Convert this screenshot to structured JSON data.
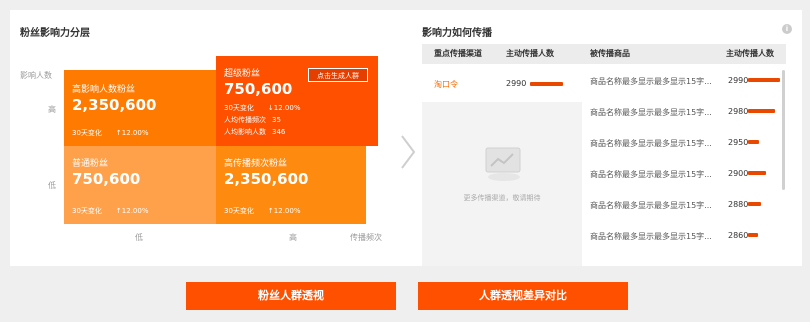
{
  "left": {
    "title": "粉丝影响力分层",
    "y_axis_label": "影响人数",
    "y_high": "高",
    "y_low": "低",
    "x_low": "低",
    "x_high": "高",
    "x_axis_label": "传播频次",
    "quadrants": {
      "high_influence": {
        "name": "高影响人数粉丝",
        "value": "2,350,600",
        "change_label": "30天变化",
        "change_value": "↑12.00%"
      },
      "super": {
        "name": "超级粉丝",
        "value": "750,600",
        "change_label": "30天变化",
        "change_value": "↓12.00%",
        "spread_label": "人均传播频次",
        "spread_value": "35",
        "influence_label": "人均影响人数",
        "influence_value": "346",
        "button": "点击生成人群"
      },
      "normal": {
        "name": "普通粉丝",
        "value": "750,600",
        "change_label": "30天变化",
        "change_value": "↑12.00%"
      },
      "high_freq": {
        "name": "高传播频次粉丝",
        "value": "2,350,600",
        "change_label": "30天变化",
        "change_value": "↑12.00%"
      }
    }
  },
  "right": {
    "title": "影响力如何传播",
    "columns": [
      "重点传播渠道",
      "主动传播人数",
      "被传播商品",
      "主动传播人数"
    ],
    "channel": {
      "name": "淘口令",
      "value": "2990",
      "bar": 0.55
    },
    "placeholder_text": "更多传播渠道，敬请期待",
    "products": [
      {
        "name": "商品名称最多显示最多显示15字...",
        "value": "2990",
        "bar": 1.0
      },
      {
        "name": "商品名称最多显示最多显示15字...",
        "value": "2980",
        "bar": 0.85
      },
      {
        "name": "商品名称最多显示最多显示15字...",
        "value": "2950",
        "bar": 0.35
      },
      {
        "name": "商品名称最多显示最多显示15字...",
        "value": "2900",
        "bar": 0.55
      },
      {
        "name": "商品名称最多显示最多显示15字...",
        "value": "2880",
        "bar": 0.4
      },
      {
        "name": "商品名称最多显示最多显示15字...",
        "value": "2860",
        "bar": 0.3
      }
    ]
  },
  "buttons": {
    "fans_insight": "粉丝人群透视",
    "compare": "人群透视差异对比"
  },
  "colors": {
    "q_high_influence": "#ff7a00",
    "q_super": "#ff5000",
    "q_normal": "#ffa04a",
    "q_high_freq": "#ff8a10",
    "accent": "#ff5000"
  }
}
